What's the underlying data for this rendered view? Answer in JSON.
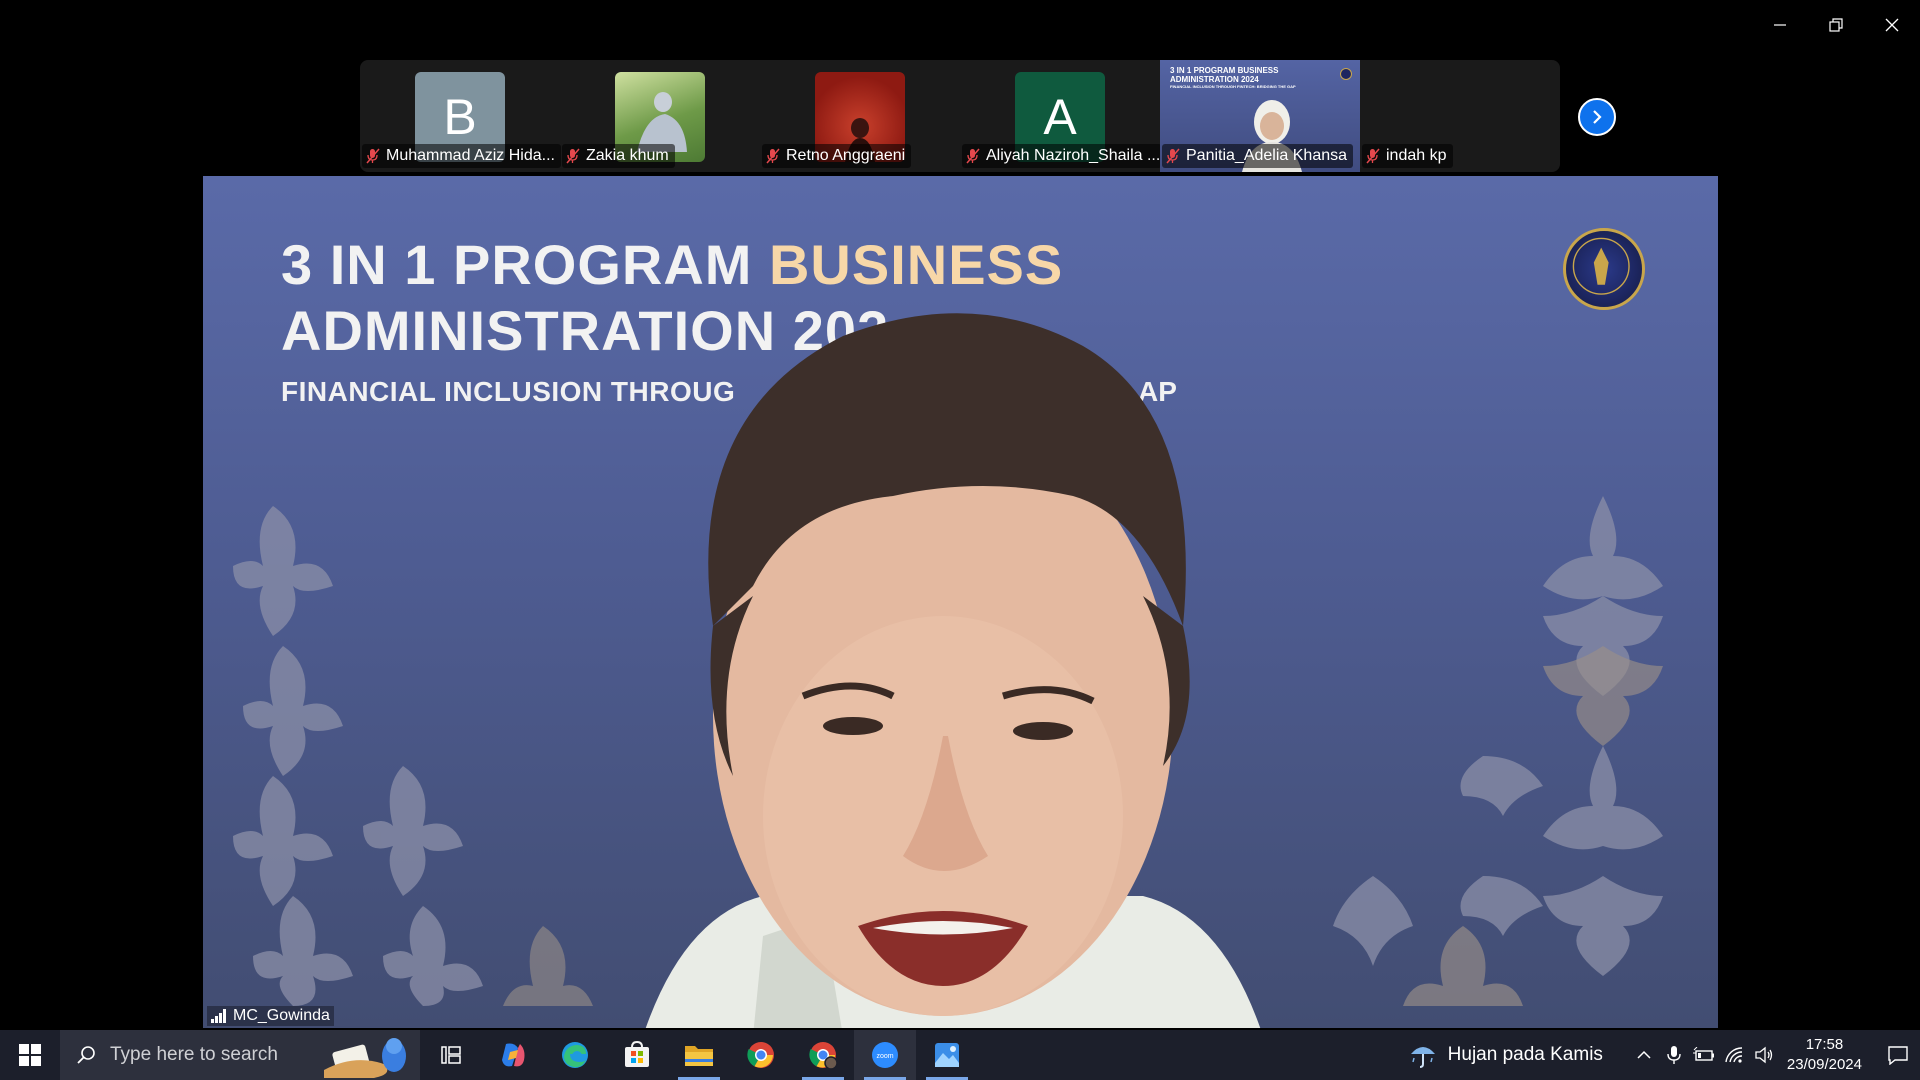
{
  "participants": [
    {
      "name": "Muhammad Aziz Hida...",
      "initial": "B",
      "avatar_color": "#7f939e"
    },
    {
      "name": "Zakia khum",
      "initial": "",
      "avatar_color": "#7fa85a"
    },
    {
      "name": "Retno Anggraeni",
      "initial": "",
      "avatar_color": "#a8281c"
    },
    {
      "name": "Aliyah Naziroh_Shaila ...",
      "initial": "A",
      "avatar_color": "#0f5a3e"
    },
    {
      "name": "Panitia_Adelia Khansa",
      "initial": "",
      "avatar_color": "#4a5690"
    },
    {
      "name": "indah kp",
      "initial": "",
      "avatar_color": "#1a1a1a"
    }
  ],
  "mini_slide": {
    "line1": "3 IN 1 PROGRAM BUSINESS",
    "line2": "ADMINISTRATION 2024",
    "line3": "FINANCIAL INCLUSION THROUGH FINTECH: BRIDGING THE GAP"
  },
  "slide": {
    "title_part1": "3 IN 1 PROGRAM ",
    "title_part2": "BUSINESS",
    "title_line2": "ADMINISTRATION 202",
    "subtitle": "FINANCIAL INCLUSION THROUG",
    "subtitle_tail": "AP"
  },
  "speaker": {
    "name": "MC_Gowinda"
  },
  "taskbar": {
    "search_placeholder": "Type here to search",
    "weather": "Hujan pada Kamis",
    "time": "17:58",
    "date": "23/09/2024"
  },
  "icons": {
    "window": [
      "minimize-icon",
      "restore-icon",
      "close-icon"
    ],
    "taskbar": [
      "windows-start-icon",
      "search-icon",
      "task-view-icon",
      "copilot-icon",
      "edge-icon",
      "store-icon",
      "file-explorer-icon",
      "chrome-icon",
      "chrome-profile-icon",
      "zoom-icon",
      "photos-icon"
    ],
    "tray": [
      "chevron-up-icon",
      "microphone-icon",
      "battery-icon",
      "wifi-icon",
      "volume-icon",
      "notification-icon"
    ]
  },
  "colors": {
    "accent": "#0e72ed",
    "highlight": "#f7d7a8",
    "mute": "#e5484d"
  }
}
